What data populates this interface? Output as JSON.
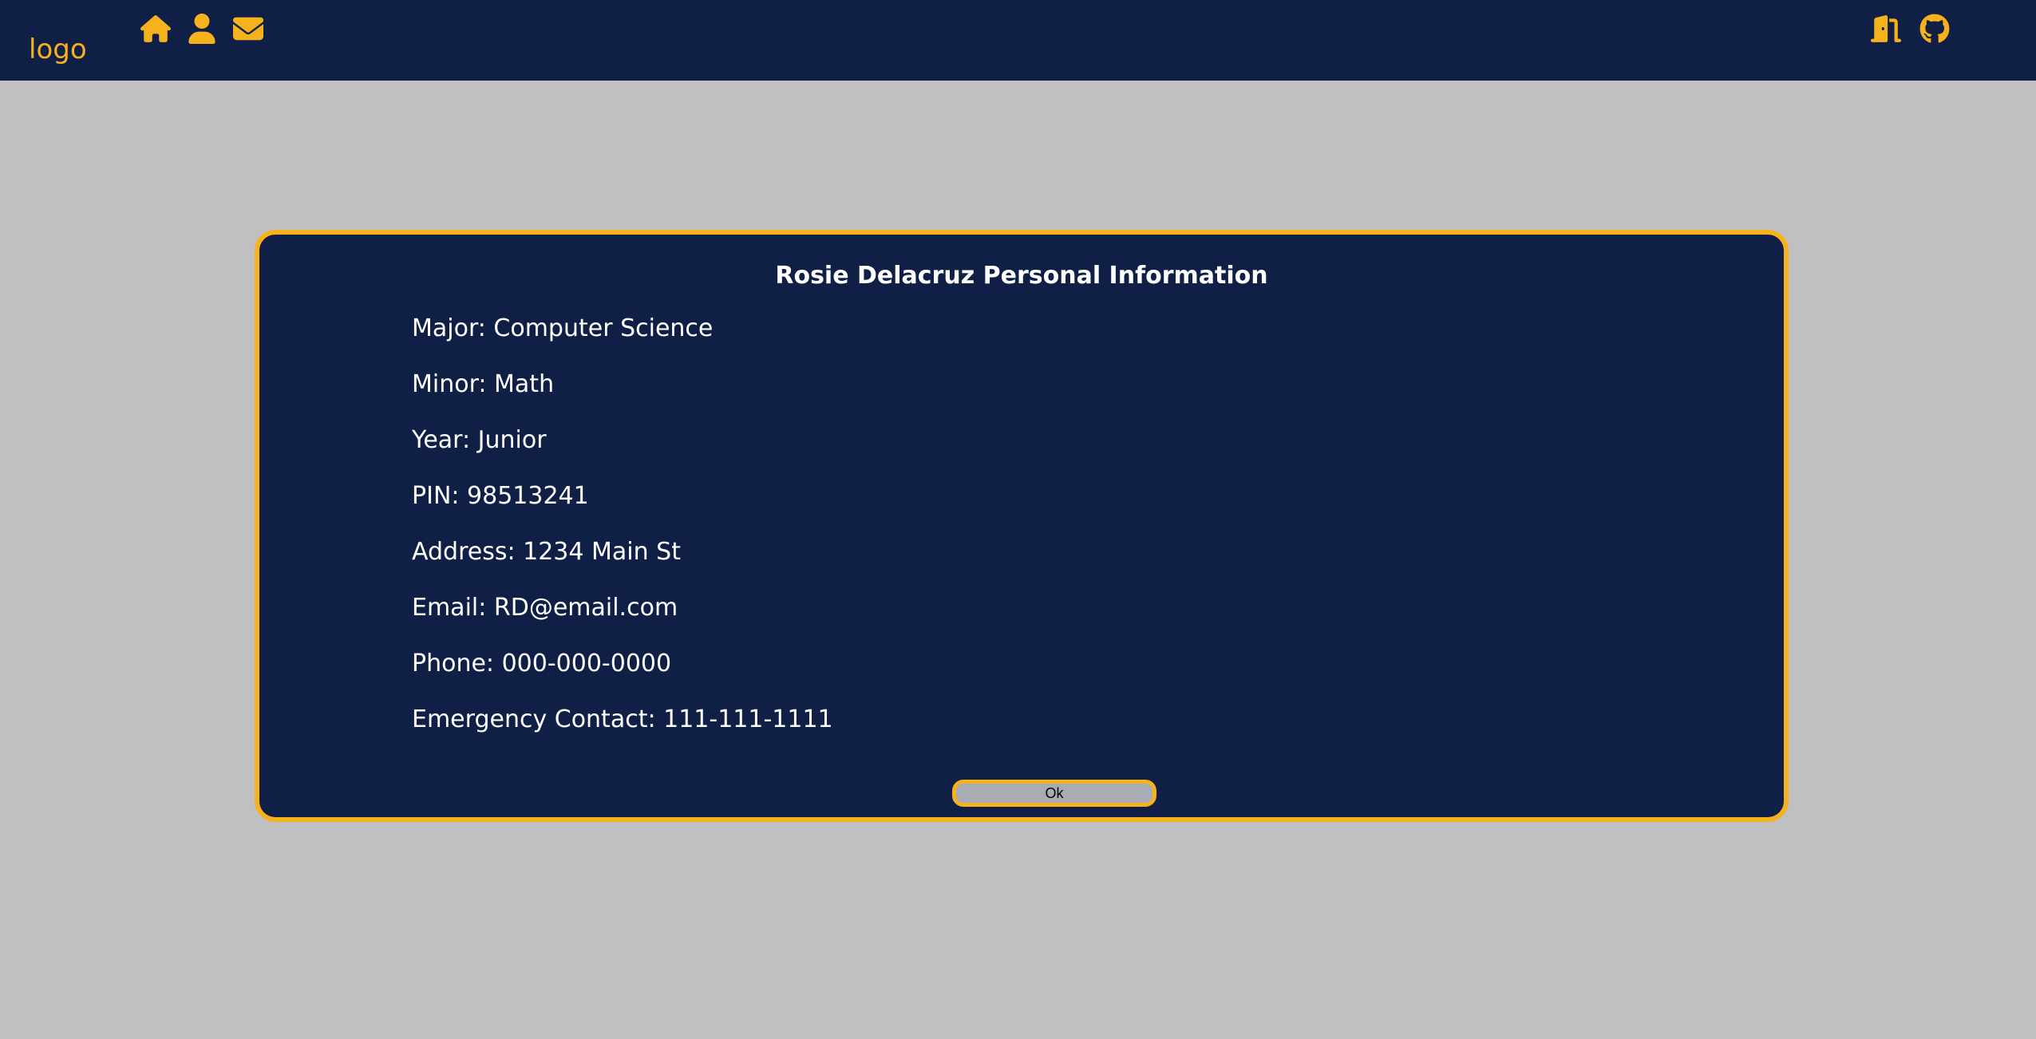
{
  "navbar": {
    "logo_text": "logo",
    "left_icons": [
      "home-icon",
      "user-icon",
      "envelope-icon"
    ],
    "right_icons": [
      "door-exit-icon",
      "github-icon"
    ],
    "background_color": "#101f45",
    "accent_color": "#f5b21c"
  },
  "card": {
    "title": "Rosie Delacruz Personal Information",
    "items": [
      "Major: Computer Science",
      "Minor: Math",
      "Year: Junior",
      "PIN: 98513241",
      "Address: 1234 Main St",
      "Email: RD@email.com",
      "Phone: 000-000-0000",
      "Emergency Contact: 111-111-1111"
    ],
    "ok_label": "Ok"
  },
  "page": {
    "background_color": "#c0c0c2"
  }
}
